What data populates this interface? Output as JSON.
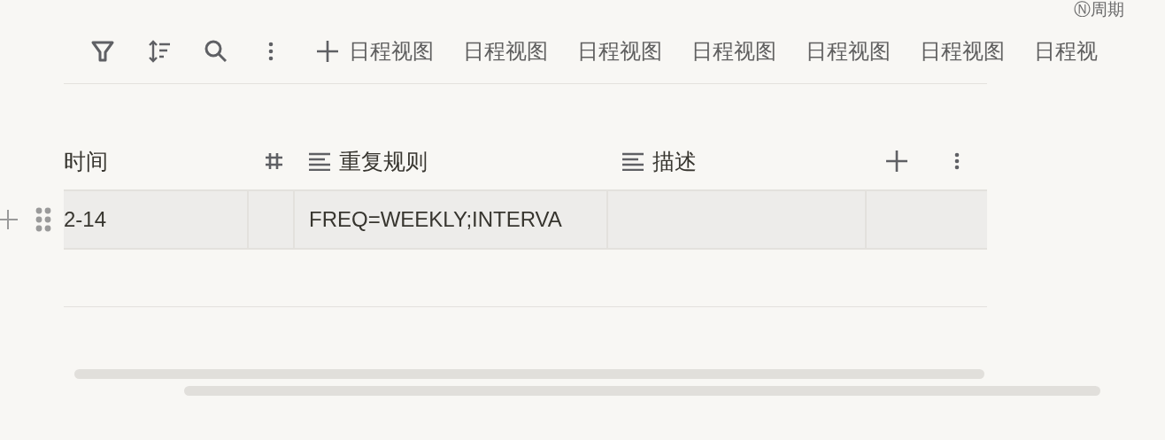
{
  "corner_tag": "Ⓝ周期",
  "toolbar": {
    "views": [
      {
        "label": "日程视图"
      },
      {
        "label": "日程视图"
      },
      {
        "label": "日程视图"
      },
      {
        "label": "日程视图"
      },
      {
        "label": "日程视图"
      },
      {
        "label": "日程视图"
      },
      {
        "label": "日程视"
      }
    ]
  },
  "table": {
    "columns": [
      {
        "label": "时间",
        "kind": "plain"
      },
      {
        "kind": "number"
      },
      {
        "label": "重复规则",
        "kind": "text"
      },
      {
        "label": "描述",
        "kind": "text"
      }
    ],
    "rows": [
      [
        "2-14",
        "",
        "FREQ=WEEKLY;INTERVA",
        ""
      ]
    ]
  }
}
